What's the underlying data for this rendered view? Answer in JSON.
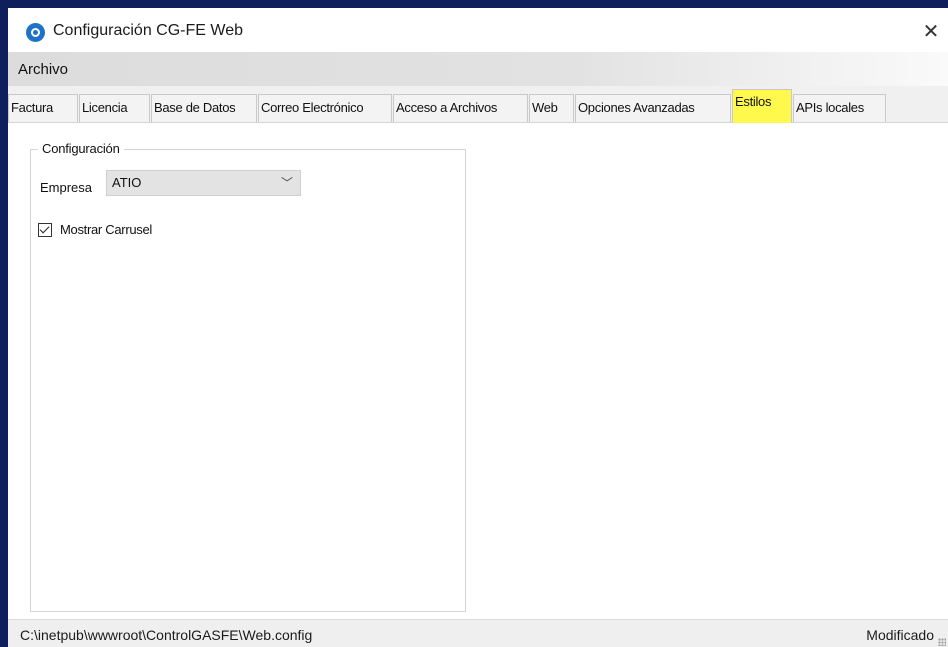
{
  "window": {
    "title": "Configuración CG-FE Web",
    "icon": "gear-icon",
    "close_glyph": "✕"
  },
  "menu": {
    "items": [
      "Archivo"
    ]
  },
  "tabs": [
    {
      "label": "Factura",
      "active": false
    },
    {
      "label": "Licencia",
      "active": false
    },
    {
      "label": "Base de Datos",
      "active": false
    },
    {
      "label": "Correo Electrónico",
      "active": false
    },
    {
      "label": "Acceso a Archivos",
      "active": false
    },
    {
      "label": "Web",
      "active": false
    },
    {
      "label": "Opciones Avanzadas",
      "active": false
    },
    {
      "label": "Estilos",
      "active": true
    },
    {
      "label": "APIs locales",
      "active": false
    }
  ],
  "group": {
    "legend": "Configuración",
    "empresa_label": "Empresa",
    "empresa_value": "ATIO",
    "empresa_arrow": "﹀",
    "carrusel_label": "Mostrar Carrusel",
    "carrusel_checked": true
  },
  "status": {
    "path": "C:\\inetpub\\wwwroot\\ControlGASFE\\Web.config",
    "state": "Modificado"
  },
  "colors": {
    "active_tab_highlight": "#fff94e",
    "icon_blue": "#1e73c8",
    "frame": "#0f1f5c"
  }
}
